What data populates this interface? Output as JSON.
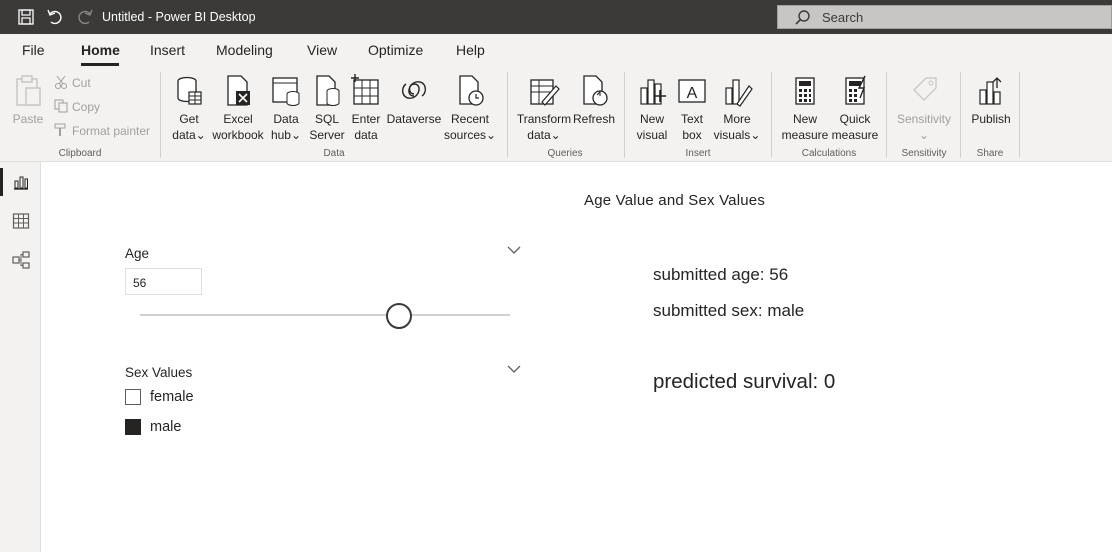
{
  "window": {
    "title": "Untitled - Power BI Desktop",
    "search_placeholder": "Search"
  },
  "menu": {
    "tabs": [
      "File",
      "Home",
      "Insert",
      "Modeling",
      "View",
      "Optimize",
      "Help"
    ],
    "active": "Home"
  },
  "ribbon": {
    "clipboard": {
      "paste": "Paste",
      "cut": "Cut",
      "copy": "Copy",
      "format_painter": "Format painter",
      "group": "Clipboard"
    },
    "data": {
      "get_data": [
        "Get",
        "data"
      ],
      "excel": [
        "Excel",
        "workbook"
      ],
      "data_hub": [
        "Data",
        "hub"
      ],
      "sql": [
        "SQL",
        "Server"
      ],
      "enter": [
        "Enter",
        "data"
      ],
      "dataverse": "Dataverse",
      "recent": [
        "Recent",
        "sources"
      ],
      "group": "Data"
    },
    "queries": {
      "transform": [
        "Transform",
        "data"
      ],
      "refresh": "Refresh",
      "group": "Queries"
    },
    "insert": {
      "new_visual": [
        "New",
        "visual"
      ],
      "text_box": [
        "Text",
        "box"
      ],
      "more_visuals": [
        "More",
        "visuals"
      ],
      "group": "Insert"
    },
    "calculations": {
      "new_measure": [
        "New",
        "measure"
      ],
      "quick_measure": [
        "Quick",
        "measure"
      ],
      "group": "Calculations"
    },
    "sensitivity": {
      "label": "Sensitivity",
      "group": "Sensitivity"
    },
    "share": {
      "publish": "Publish",
      "group": "Share"
    }
  },
  "report": {
    "title": "Age Value and Sex Values",
    "age_slicer": {
      "label": "Age",
      "value": "56",
      "slider_fraction": 0.7
    },
    "sex_slicer": {
      "label": "Sex Values",
      "options": [
        "female",
        "male"
      ],
      "checked": [
        false,
        true
      ]
    },
    "cards": {
      "submitted_age": "submitted age: 56",
      "submitted_sex": "submitted sex: male",
      "prediction": "predicted survival: 0"
    }
  }
}
